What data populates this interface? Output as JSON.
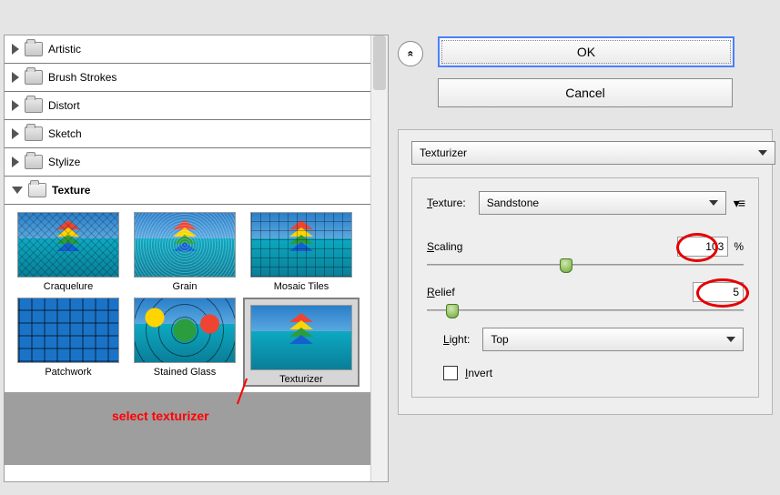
{
  "categories": {
    "artistic": "Artistic",
    "brush": "Brush Strokes",
    "distort": "Distort",
    "sketch": "Sketch",
    "stylize": "Stylize",
    "texture": "Texture"
  },
  "thumbs": {
    "craquelure": "Craquelure",
    "grain": "Grain",
    "mosaic": "Mosaic Tiles",
    "patchwork": "Patchwork",
    "stained": "Stained Glass",
    "texturizer": "Texturizer"
  },
  "buttons": {
    "ok": "OK",
    "cancel": "Cancel"
  },
  "filter_select": "Texturizer",
  "texture": {
    "label": "Texture:",
    "value": "Sandstone"
  },
  "scaling": {
    "label": "Scaling",
    "value": "103",
    "unit": "%"
  },
  "relief": {
    "label": "Relief",
    "value": "5"
  },
  "light": {
    "label": "Light:",
    "value": "Top"
  },
  "invert": "Invert",
  "annotation": "select texturizer",
  "collapse_glyph": "«"
}
